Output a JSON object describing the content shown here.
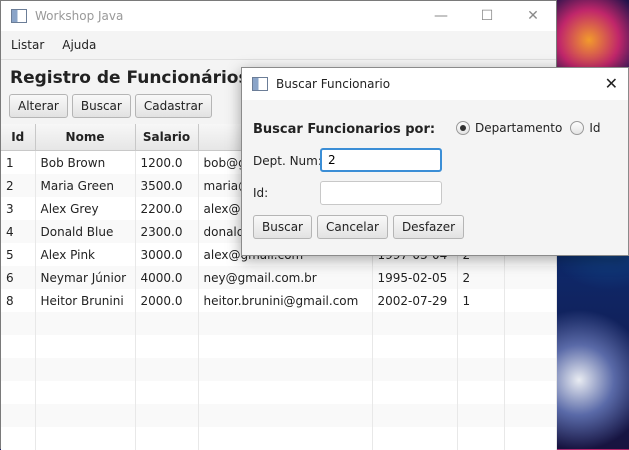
{
  "main_window": {
    "title": "Workshop Java",
    "menu": [
      "Listar",
      "Ajuda"
    ],
    "page_title": "Registro de Funcionários",
    "toolbar": {
      "alterar": "Alterar",
      "buscar": "Buscar",
      "cadastrar": "Cadastrar"
    },
    "table": {
      "headers": [
        "Id",
        "Nome",
        "Salario"
      ],
      "rows": [
        [
          "1",
          "Bob Brown",
          "1200.0",
          "bob@g",
          "",
          ""
        ],
        [
          "2",
          "Maria Green",
          "3500.0",
          "maria@",
          "",
          ""
        ],
        [
          "3",
          "Alex Grey",
          "2200.0",
          "alex@g",
          "",
          ""
        ],
        [
          "4",
          "Donald Blue",
          "2300.0",
          "donald",
          "",
          ""
        ],
        [
          "5",
          "Alex Pink",
          "3000.0",
          "alex@gmail.com",
          "1997-03-04",
          "2"
        ],
        [
          "6",
          "Neymar Júnior",
          "4000.0",
          "ney@gmail.com.br",
          "1995-02-05",
          "2"
        ],
        [
          "8",
          "Heitor Brunini",
          "2000.0",
          "heitor.brunini@gmail.com",
          "2002-07-29",
          "1"
        ]
      ]
    }
  },
  "dialog": {
    "title": "Buscar Funcionario",
    "heading": "Buscar Funcionarios por:",
    "radio_departamento": "Departamento",
    "radio_id": "Id",
    "dept_label": "Dept. Num:",
    "dept_value": "2",
    "id_label": "Id:",
    "id_value": "",
    "buttons": {
      "buscar": "Buscar",
      "cancelar": "Cancelar",
      "desfazer": "Desfazer"
    }
  }
}
